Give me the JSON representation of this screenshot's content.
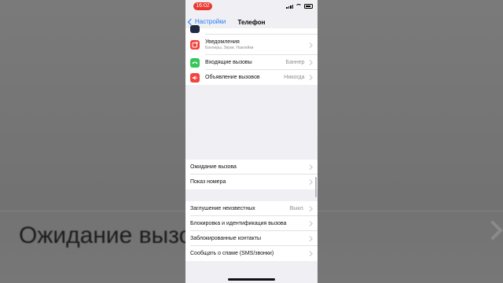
{
  "status": {
    "time": "16:02"
  },
  "nav": {
    "back_label": "Настройки",
    "title": "Телефон"
  },
  "group1": [
    {
      "label": "Уведомления",
      "sub": "Баннеры, Звуки, Наклейки",
      "value": "",
      "icon": "notifications-icon",
      "color": "#f2453d"
    },
    {
      "label": "Входящие вызовы",
      "sub": "",
      "value": "Баннер",
      "icon": "incoming-calls-icon",
      "color": "#34c759"
    },
    {
      "label": "Объявление вызовов",
      "sub": "",
      "value": "Никогда",
      "icon": "announce-calls-icon",
      "color": "#f2453d"
    }
  ],
  "group2": [
    {
      "label": "Ожидание вызова",
      "value": ""
    },
    {
      "label": "Показ номера",
      "value": ""
    }
  ],
  "group3": [
    {
      "label": "Заглушение неизвестных",
      "value": "Выкл."
    },
    {
      "label": "Блокировка и идентификация вызова",
      "value": ""
    },
    {
      "label": "Заблокированные контакты",
      "value": ""
    },
    {
      "label": "Сообщать о спаме (SMS/звонки)",
      "value": ""
    }
  ],
  "background": {
    "zoom_text": "Ожидание вызо"
  }
}
